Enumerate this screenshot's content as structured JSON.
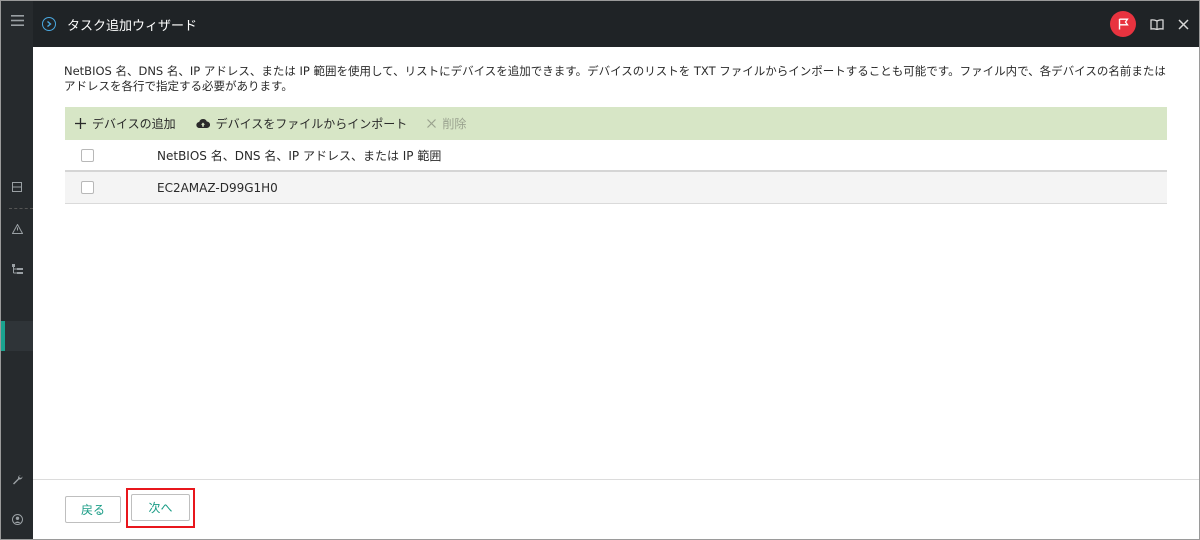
{
  "window": {
    "title": "タスク追加ウィザード",
    "accent": "#1aa38f",
    "flag_color": "#e8333f",
    "toolbar_bg": "#d7e6c6"
  },
  "description": "NetBIOS 名、DNS 名、IP アドレス、または IP 範囲を使用して、リストにデバイスを追加できます。デバイスのリストを TXT ファイルからインポートすることも可能です。ファイル内で、各デバイスの名前またはアドレスを各行で指定する必要があります。",
  "toolbar": {
    "add_label": "デバイスの追加",
    "import_label": "デバイスをファイルからインポート",
    "delete_label": "削除"
  },
  "table": {
    "header": "NetBIOS 名、DNS 名、IP アドレス、または IP 範囲",
    "rows": [
      {
        "value": "EC2AMAZ-D99G1H0",
        "checked": false
      }
    ]
  },
  "footer": {
    "back_label": "戻る",
    "next_label": "次へ"
  },
  "icons": {
    "header": "wizard-circle-icon",
    "flag": "flag-icon",
    "book": "book-icon",
    "close": "close-icon"
  }
}
